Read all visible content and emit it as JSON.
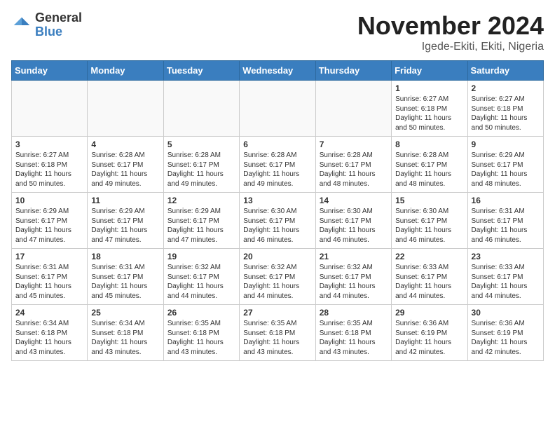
{
  "header": {
    "logo_general": "General",
    "logo_blue": "Blue",
    "month_title": "November 2024",
    "location": "Igede-Ekiti, Ekiti, Nigeria"
  },
  "weekdays": [
    "Sunday",
    "Monday",
    "Tuesday",
    "Wednesday",
    "Thursday",
    "Friday",
    "Saturday"
  ],
  "weeks": [
    [
      {
        "day": "",
        "info": ""
      },
      {
        "day": "",
        "info": ""
      },
      {
        "day": "",
        "info": ""
      },
      {
        "day": "",
        "info": ""
      },
      {
        "day": "",
        "info": ""
      },
      {
        "day": "1",
        "info": "Sunrise: 6:27 AM\nSunset: 6:18 PM\nDaylight: 11 hours\nand 50 minutes."
      },
      {
        "day": "2",
        "info": "Sunrise: 6:27 AM\nSunset: 6:18 PM\nDaylight: 11 hours\nand 50 minutes."
      }
    ],
    [
      {
        "day": "3",
        "info": "Sunrise: 6:27 AM\nSunset: 6:18 PM\nDaylight: 11 hours\nand 50 minutes."
      },
      {
        "day": "4",
        "info": "Sunrise: 6:28 AM\nSunset: 6:17 PM\nDaylight: 11 hours\nand 49 minutes."
      },
      {
        "day": "5",
        "info": "Sunrise: 6:28 AM\nSunset: 6:17 PM\nDaylight: 11 hours\nand 49 minutes."
      },
      {
        "day": "6",
        "info": "Sunrise: 6:28 AM\nSunset: 6:17 PM\nDaylight: 11 hours\nand 49 minutes."
      },
      {
        "day": "7",
        "info": "Sunrise: 6:28 AM\nSunset: 6:17 PM\nDaylight: 11 hours\nand 48 minutes."
      },
      {
        "day": "8",
        "info": "Sunrise: 6:28 AM\nSunset: 6:17 PM\nDaylight: 11 hours\nand 48 minutes."
      },
      {
        "day": "9",
        "info": "Sunrise: 6:29 AM\nSunset: 6:17 PM\nDaylight: 11 hours\nand 48 minutes."
      }
    ],
    [
      {
        "day": "10",
        "info": "Sunrise: 6:29 AM\nSunset: 6:17 PM\nDaylight: 11 hours\nand 47 minutes."
      },
      {
        "day": "11",
        "info": "Sunrise: 6:29 AM\nSunset: 6:17 PM\nDaylight: 11 hours\nand 47 minutes."
      },
      {
        "day": "12",
        "info": "Sunrise: 6:29 AM\nSunset: 6:17 PM\nDaylight: 11 hours\nand 47 minutes."
      },
      {
        "day": "13",
        "info": "Sunrise: 6:30 AM\nSunset: 6:17 PM\nDaylight: 11 hours\nand 46 minutes."
      },
      {
        "day": "14",
        "info": "Sunrise: 6:30 AM\nSunset: 6:17 PM\nDaylight: 11 hours\nand 46 minutes."
      },
      {
        "day": "15",
        "info": "Sunrise: 6:30 AM\nSunset: 6:17 PM\nDaylight: 11 hours\nand 46 minutes."
      },
      {
        "day": "16",
        "info": "Sunrise: 6:31 AM\nSunset: 6:17 PM\nDaylight: 11 hours\nand 46 minutes."
      }
    ],
    [
      {
        "day": "17",
        "info": "Sunrise: 6:31 AM\nSunset: 6:17 PM\nDaylight: 11 hours\nand 45 minutes."
      },
      {
        "day": "18",
        "info": "Sunrise: 6:31 AM\nSunset: 6:17 PM\nDaylight: 11 hours\nand 45 minutes."
      },
      {
        "day": "19",
        "info": "Sunrise: 6:32 AM\nSunset: 6:17 PM\nDaylight: 11 hours\nand 44 minutes."
      },
      {
        "day": "20",
        "info": "Sunrise: 6:32 AM\nSunset: 6:17 PM\nDaylight: 11 hours\nand 44 minutes."
      },
      {
        "day": "21",
        "info": "Sunrise: 6:32 AM\nSunset: 6:17 PM\nDaylight: 11 hours\nand 44 minutes."
      },
      {
        "day": "22",
        "info": "Sunrise: 6:33 AM\nSunset: 6:17 PM\nDaylight: 11 hours\nand 44 minutes."
      },
      {
        "day": "23",
        "info": "Sunrise: 6:33 AM\nSunset: 6:17 PM\nDaylight: 11 hours\nand 44 minutes."
      }
    ],
    [
      {
        "day": "24",
        "info": "Sunrise: 6:34 AM\nSunset: 6:18 PM\nDaylight: 11 hours\nand 43 minutes."
      },
      {
        "day": "25",
        "info": "Sunrise: 6:34 AM\nSunset: 6:18 PM\nDaylight: 11 hours\nand 43 minutes."
      },
      {
        "day": "26",
        "info": "Sunrise: 6:35 AM\nSunset: 6:18 PM\nDaylight: 11 hours\nand 43 minutes."
      },
      {
        "day": "27",
        "info": "Sunrise: 6:35 AM\nSunset: 6:18 PM\nDaylight: 11 hours\nand 43 minutes."
      },
      {
        "day": "28",
        "info": "Sunrise: 6:35 AM\nSunset: 6:18 PM\nDaylight: 11 hours\nand 43 minutes."
      },
      {
        "day": "29",
        "info": "Sunrise: 6:36 AM\nSunset: 6:19 PM\nDaylight: 11 hours\nand 42 minutes."
      },
      {
        "day": "30",
        "info": "Sunrise: 6:36 AM\nSunset: 6:19 PM\nDaylight: 11 hours\nand 42 minutes."
      }
    ]
  ]
}
